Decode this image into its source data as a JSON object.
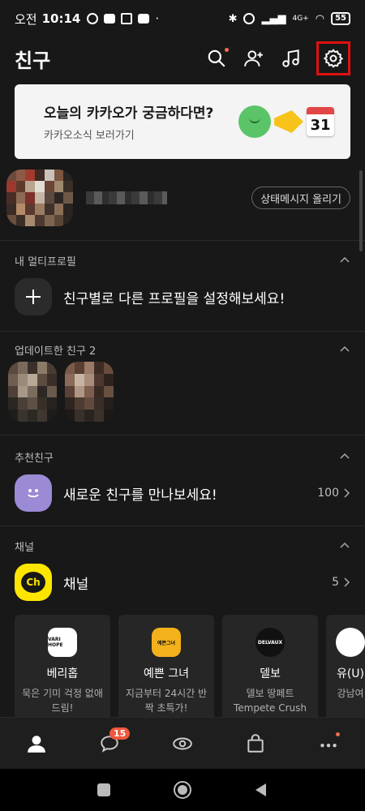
{
  "status_bar": {
    "ampm": "오전",
    "time": "10:14",
    "network": "4G+",
    "battery": "55"
  },
  "header": {
    "title": "친구"
  },
  "banner": {
    "title": "오늘의 카카오가 궁금하다면?",
    "subtitle": "카카오소식 보러가기",
    "calendar_day": "31"
  },
  "my_profile": {
    "status_button": "상태메시지 올리기"
  },
  "multi_profile": {
    "section_title": "내 멀티프로필",
    "prompt": "친구별로 다른 프로필을 설정해보세요!"
  },
  "updated_friends": {
    "section_title": "업데이트한 친구 2"
  },
  "recommended": {
    "section_title": "추천친구",
    "label": "새로운 친구를 만나보세요!",
    "count": "100"
  },
  "channel": {
    "section_title": "채널",
    "label": "채널",
    "count": "5",
    "tile_text": "Ch",
    "cards": [
      {
        "name": "베리홉",
        "desc": "묵은 기미 걱정 없애드림!",
        "logo_text": "VARI HOPE"
      },
      {
        "name": "예쁜 그녀",
        "desc": "지금부터 24시간 반짝 초특가!",
        "logo_text": "예쁜그녀"
      },
      {
        "name": "델보",
        "desc": "델보 땅페트 Tempete Crush",
        "logo_text": "DELVAUX"
      },
      {
        "name": "유(U)",
        "desc": "강남여"
      }
    ]
  },
  "bottom_nav": {
    "chat_badge": "15"
  },
  "colors": {
    "background": "#181818",
    "kakao_yellow": "#fee500",
    "accent_red": "#f0573d",
    "highlight_box": "#e01010"
  }
}
